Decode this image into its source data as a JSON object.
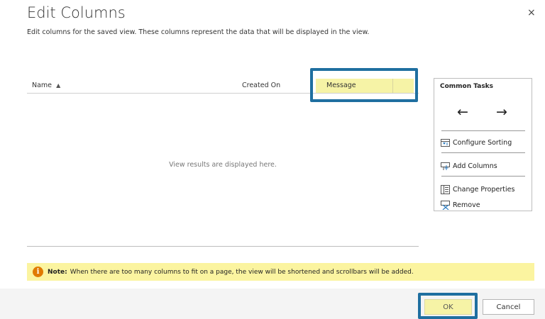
{
  "dialog": {
    "title": "Edit Columns",
    "close_glyph": "×",
    "subtitle": "Edit columns for the saved view. These columns represent the data that will be displayed in the view."
  },
  "grid": {
    "columns": [
      {
        "label": "Name",
        "sort": "ascending"
      },
      {
        "label": "Created On"
      },
      {
        "label": "Message",
        "selected": true
      }
    ],
    "sort_glyph": "▲",
    "empty_message": "View results are displayed here."
  },
  "common_tasks": {
    "title": "Common Tasks",
    "left_arrow": "←",
    "right_arrow": "→",
    "items": [
      {
        "label": "Configure Sorting",
        "icon": "configure-sorting-icon"
      },
      {
        "label": "Add Columns",
        "icon": "add-columns-icon"
      },
      {
        "label": "Change Properties",
        "icon": "change-properties-icon"
      },
      {
        "label": "Remove",
        "icon": "remove-icon"
      }
    ]
  },
  "note": {
    "icon_glyph": "i",
    "label": "Note:",
    "text": "When there are too many columns to fit on a page, the view will be shortened and scrollbars will be added."
  },
  "footer": {
    "ok_label": "OK",
    "cancel_label": "Cancel"
  },
  "colors": {
    "highlight_border": "#1f6fa0",
    "selected_fill": "#f6f3a6",
    "note_background": "#fbf4a0",
    "info_icon": "#e07a00"
  }
}
